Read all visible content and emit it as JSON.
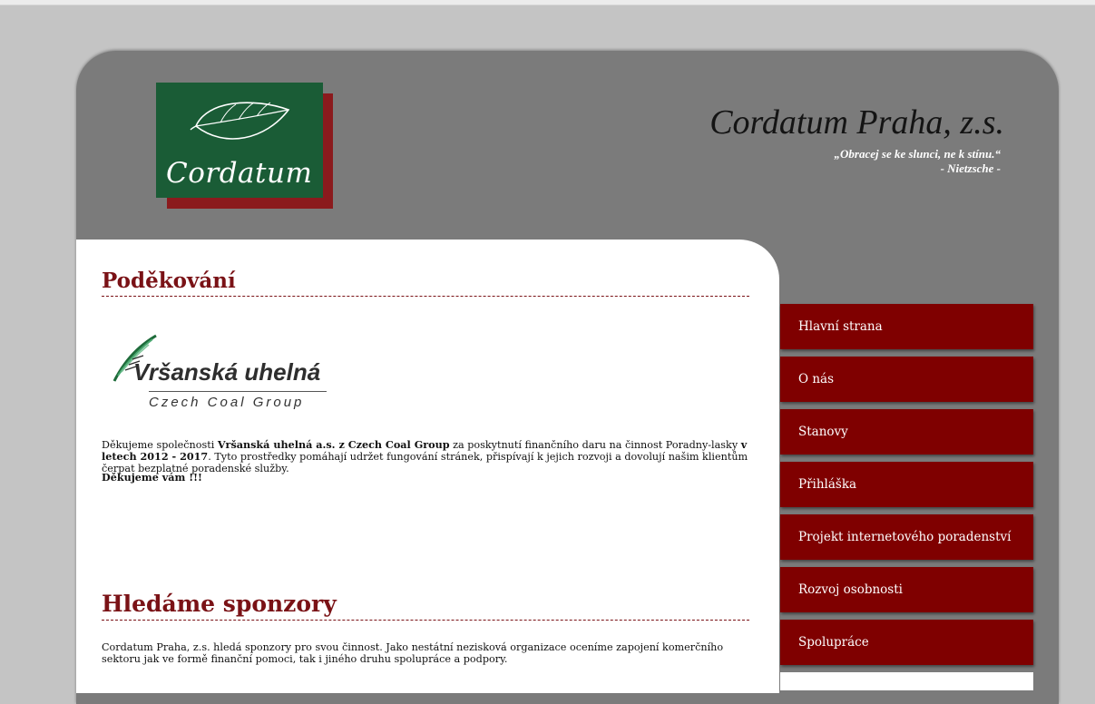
{
  "header": {
    "site_title": "Cordatum Praha, z.s.",
    "motto_line1": "„Obracej se ke slunci, ne k stínu.“",
    "motto_line2": "- Nietzsche -",
    "logo_text": "Cordatum"
  },
  "thanks": {
    "heading": "Poděkování",
    "sponsor_logo_name": "Vršanská uhelná",
    "sponsor_logo_sub": "Czech Coal Group",
    "p1_a": "Děkujeme společnosti ",
    "p1_b": "Vršanská uhelná a.s. z Czech Coal Group",
    "p1_c": " za poskytnutí finančního daru na činnost Poradny-lasky ",
    "p1_d": "v letech 2012 - 2017",
    "p1_e": ". Tyto prostředky pomáhají udržet fungování stránek, přispívají k jejich rozvoji a dovolují našim klientům čerpat bezplatné poradenské služby.",
    "closing": "Děkujeme vám !!!"
  },
  "sponsors": {
    "heading": "Hledáme sponzory",
    "text": "Cordatum Praha, z.s. hledá sponzory pro svou činnost. Jako nestátní nezisková organizace oceníme zapojení komerčního sektoru jak ve formě finanční pomoci, tak i jiného druhu spolupráce a podpory."
  },
  "nav": {
    "items": [
      {
        "label": "Hlavní strana"
      },
      {
        "label": "O nás"
      },
      {
        "label": "Stanovy"
      },
      {
        "label": "Přihláška"
      },
      {
        "label": "Projekt internetového poradenství"
      },
      {
        "label": "Rozvoj osobnosti"
      },
      {
        "label": "Spolupráce"
      }
    ]
  },
  "colors": {
    "page_bg": "#c4c4c4",
    "frame_bg": "#7b7b7b",
    "accent": "#7f0000",
    "logo_green": "#1a5c36",
    "logo_red": "#8b1a1d"
  }
}
